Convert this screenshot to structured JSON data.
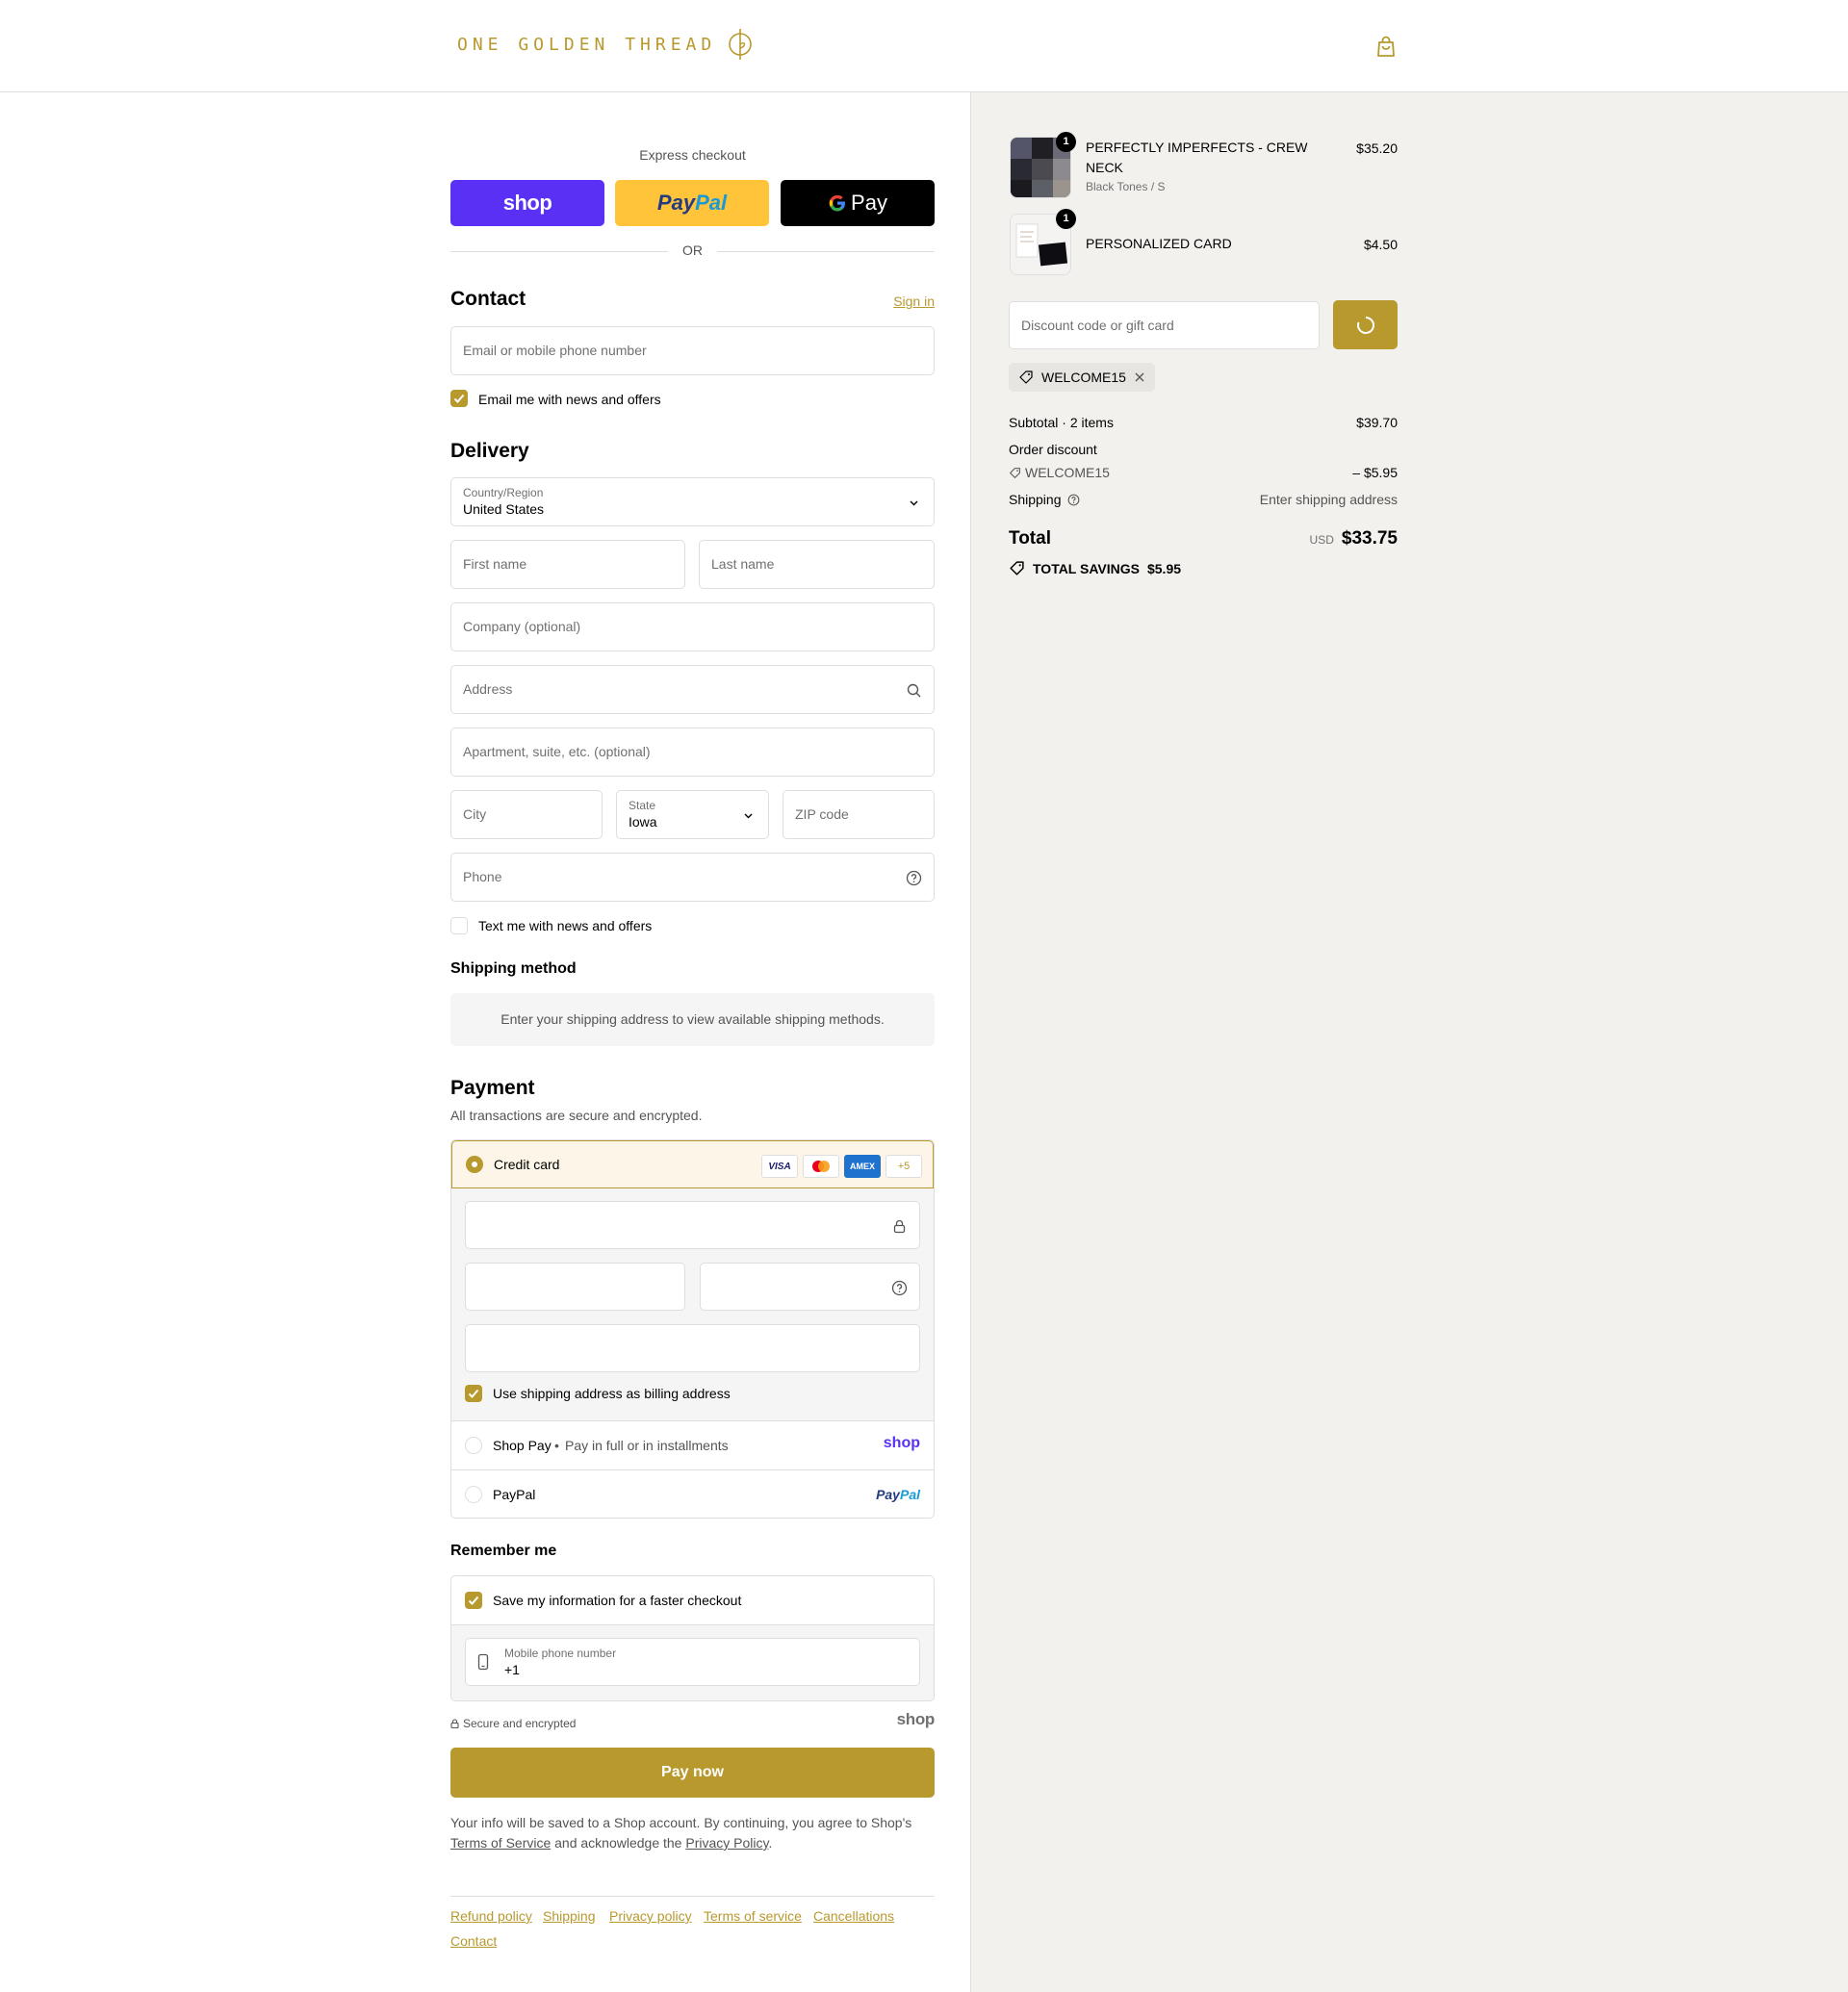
{
  "brand": {
    "name": "ONE GOLDEN THREAD"
  },
  "express": {
    "label": "Express checkout",
    "shop": "shop",
    "paypal_a": "Pay",
    "paypal_b": "Pal",
    "gpay": "Pay",
    "or": "OR"
  },
  "contact": {
    "title": "Contact",
    "signin": "Sign in",
    "email_placeholder": "Email or mobile phone number",
    "news_label": "Email me with news and offers",
    "news_checked": true
  },
  "delivery": {
    "title": "Delivery",
    "country_label": "Country/Region",
    "country_value": "United States",
    "first_name": "First name",
    "last_name": "Last name",
    "company": "Company (optional)",
    "address": "Address",
    "apartment": "Apartment, suite, etc. (optional)",
    "city": "City",
    "state_label": "State",
    "state_value": "Iowa",
    "zip": "ZIP code",
    "phone": "Phone",
    "text_label": "Text me with news and offers",
    "text_checked": false
  },
  "shipping_method": {
    "title": "Shipping method",
    "info": "Enter your shipping address to view available shipping methods."
  },
  "payment": {
    "title": "Payment",
    "subtitle": "All transactions are secure and encrypted.",
    "credit_card": "Credit card",
    "cards": [
      "VISA",
      "MC",
      "AMEX",
      "+5"
    ],
    "billing_label": "Use shipping address as billing address",
    "shop_pay": "Shop Pay",
    "shop_pay_sub": "Pay in full or in installments",
    "shop_pay_logo": "shop",
    "paypal": "PayPal",
    "paypal_logo_a": "Pay",
    "paypal_logo_b": "Pal"
  },
  "remember": {
    "title": "Remember me",
    "save_label": "Save my information for a faster checkout",
    "mobile_label": "Mobile phone number",
    "mobile_value": "+1"
  },
  "secure": {
    "label": "Secure and encrypted",
    "logo": "shop"
  },
  "pay_now": "Pay now",
  "legal": {
    "part1": "Your info will be saved to a Shop account. By continuing, you agree to Shop's ",
    "tos": "Terms of Service",
    "part2": " and acknowledge the ",
    "privacy": "Privacy Policy",
    "part3": "."
  },
  "footer": {
    "links": [
      "Refund policy",
      "Shipping",
      "Privacy policy",
      "Terms of service",
      "Cancellations",
      "Contact"
    ]
  },
  "order": {
    "items": [
      {
        "name_line1": "PERFECTLY IMPERFECTS - CREW",
        "name_line2": "NECK",
        "variant": "Black Tones / S",
        "price": "$35.20",
        "qty": "1"
      },
      {
        "name_line1": "PERSONALIZED CARD",
        "price": "$4.50",
        "qty": "1"
      }
    ],
    "discount_placeholder": "Discount code or gift card",
    "applied_code": "WELCOME15",
    "subtotal_label": "Subtotal · 2 items",
    "subtotal": "$39.70",
    "order_discount_label": "Order discount",
    "discount_code": "WELCOME15",
    "discount_amount": "– $5.95",
    "shipping_label": "Shipping",
    "shipping_value": "Enter shipping address",
    "total_label": "Total",
    "currency": "USD",
    "total": "$33.75",
    "savings_label": "TOTAL SAVINGS",
    "savings": "$5.95"
  },
  "colors": {
    "accent": "#b8992e",
    "shop": "#5a31f4",
    "paypal": "#ffc439",
    "summary_bg": "#f2f1ed"
  }
}
